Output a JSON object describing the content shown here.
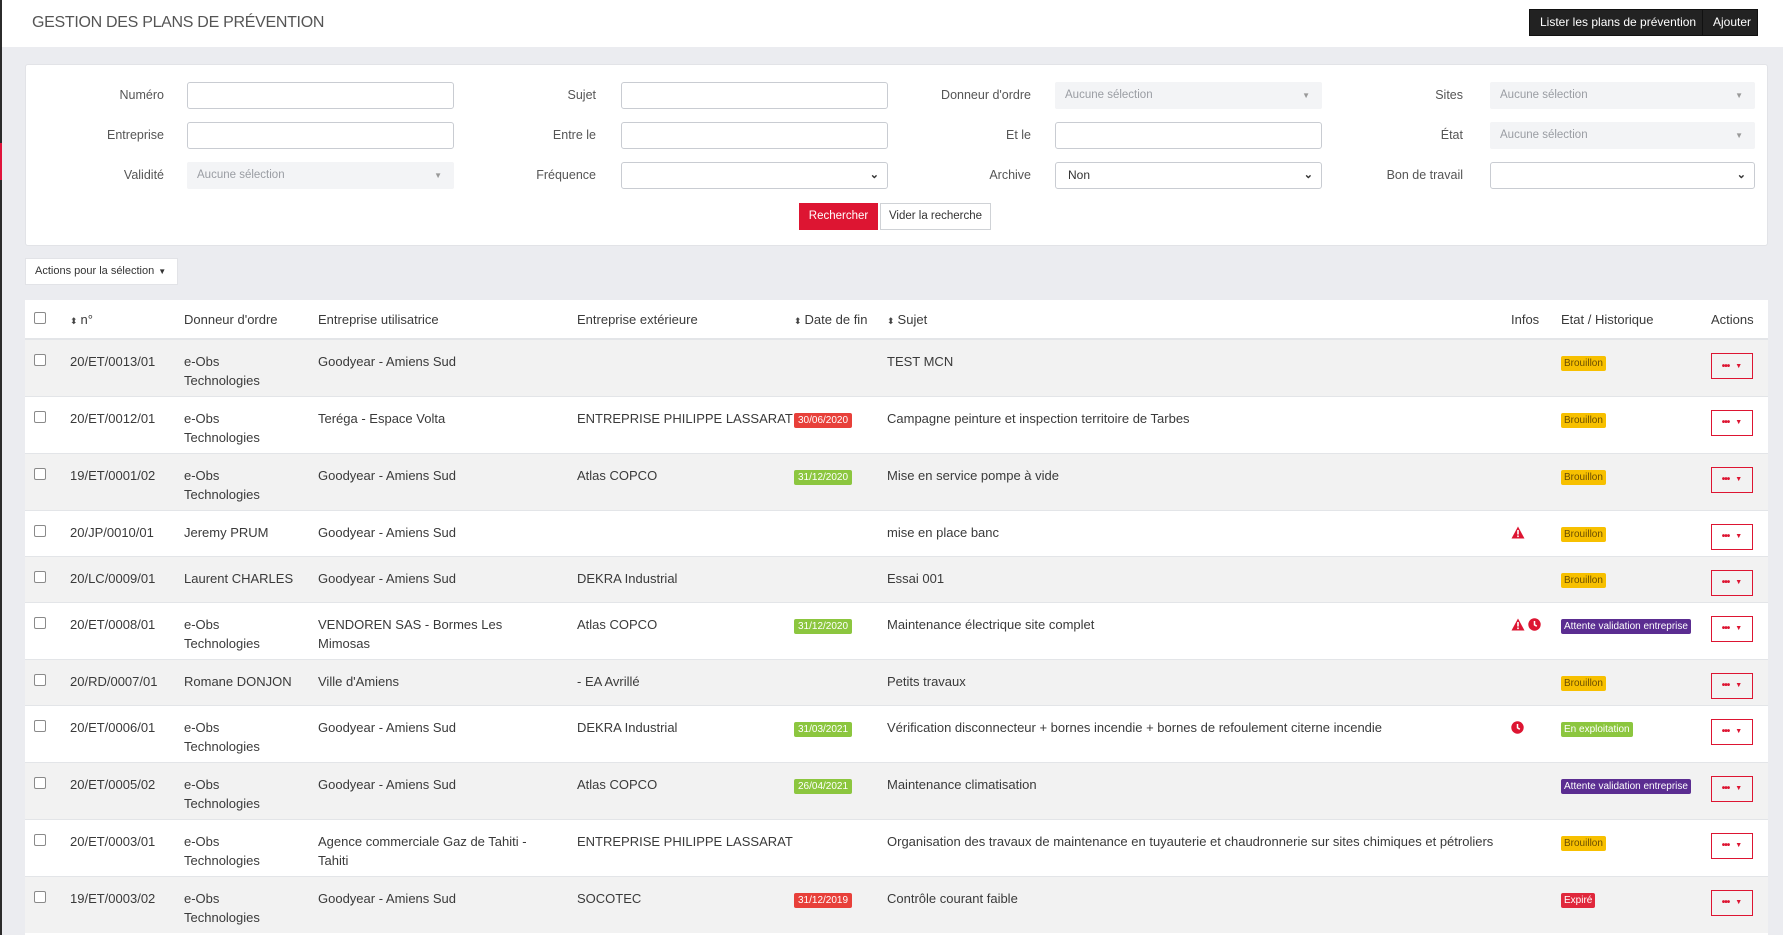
{
  "header": {
    "title": "GESTION DES PLANS DE PRÉVENTION",
    "list_button": "Lister les plans de prévention",
    "add_button": "Ajouter"
  },
  "filters": {
    "numero": {
      "label": "Numéro",
      "value": ""
    },
    "sujet": {
      "label": "Sujet",
      "value": ""
    },
    "donneur": {
      "label": "Donneur d'ordre",
      "value": "Aucune sélection"
    },
    "sites": {
      "label": "Sites",
      "value": "Aucune sélection"
    },
    "entreprise": {
      "label": "Entreprise",
      "value": ""
    },
    "entre_le": {
      "label": "Entre le",
      "value": ""
    },
    "et_le": {
      "label": "Et le",
      "value": ""
    },
    "etat": {
      "label": "État",
      "value": "Aucune sélection"
    },
    "validite": {
      "label": "Validité",
      "value": "Aucune sélection"
    },
    "frequence": {
      "label": "Fréquence",
      "value": ""
    },
    "archive": {
      "label": "Archive",
      "value": "Non"
    },
    "bon_travail": {
      "label": "Bon de travail",
      "value": ""
    },
    "search_button": "Rechercher",
    "clear_button": "Vider la recherche"
  },
  "bulk_actions": "Actions pour la sélection",
  "colors": {
    "accent_red": "#dd1532",
    "brouillon": "#f7c000",
    "attente": "#5b2d91",
    "exploitation": "#8cc63f",
    "expire": "#e0283c",
    "date_green": "#8cc63f",
    "date_red": "#e8403a"
  },
  "table": {
    "headers": {
      "num": "n°",
      "donneur": "Donneur d'ordre",
      "utilisatrice": "Entreprise utilisatrice",
      "exterieure": "Entreprise extérieure",
      "date_fin": "Date de fin",
      "sujet": "Sujet",
      "infos": "Infos",
      "etat": "Etat / Historique",
      "actions": "Actions"
    },
    "rows": [
      {
        "num": "20/ET/0013/01",
        "donneur": "e-Obs Technologies",
        "utilisatrice": "Goodyear - Amiens Sud",
        "exterieure": "",
        "date_fin": "",
        "date_status": "",
        "sujet": "TEST MCN",
        "infos": [],
        "etat": "Brouillon",
        "etat_type": "brouillon"
      },
      {
        "num": "20/ET/0012/01",
        "donneur": "e-Obs Technologies",
        "utilisatrice": "Teréga - Espace Volta",
        "exterieure": "ENTREPRISE PHILIPPE LASSARAT",
        "date_fin": "30/06/2020",
        "date_status": "red",
        "sujet": "Campagne peinture et inspection territoire de Tarbes",
        "infos": [],
        "etat": "Brouillon",
        "etat_type": "brouillon"
      },
      {
        "num": "19/ET/0001/02",
        "donneur": "e-Obs Technologies",
        "utilisatrice": "Goodyear - Amiens Sud",
        "exterieure": "Atlas COPCO",
        "date_fin": "31/12/2020",
        "date_status": "green",
        "sujet": "Mise en service pompe à vide",
        "infos": [],
        "etat": "Brouillon",
        "etat_type": "brouillon"
      },
      {
        "num": "20/JP/0010/01",
        "donneur": "Jeremy PRUM",
        "utilisatrice": "Goodyear - Amiens Sud",
        "exterieure": "",
        "date_fin": "",
        "date_status": "",
        "sujet": "mise en place banc",
        "infos": [
          "warning"
        ],
        "etat": "Brouillon",
        "etat_type": "brouillon"
      },
      {
        "num": "20/LC/0009/01",
        "donneur": "Laurent CHARLES",
        "utilisatrice": "Goodyear - Amiens Sud",
        "exterieure": "DEKRA Industrial",
        "date_fin": "",
        "date_status": "",
        "sujet": "Essai 001",
        "infos": [],
        "etat": "Brouillon",
        "etat_type": "brouillon"
      },
      {
        "num": "20/ET/0008/01",
        "donneur": "e-Obs Technologies",
        "utilisatrice": "VENDOREN SAS - Bormes Les Mimosas",
        "exterieure": "Atlas COPCO",
        "date_fin": "31/12/2020",
        "date_status": "green",
        "sujet": "Maintenance électrique site complet",
        "infos": [
          "warning",
          "clock"
        ],
        "etat": "Attente validation entreprise",
        "etat_type": "attente"
      },
      {
        "num": "20/RD/0007/01",
        "donneur": "Romane DONJON",
        "utilisatrice": "Ville d'Amiens",
        "exterieure": "- EA Avrillé",
        "date_fin": "",
        "date_status": "",
        "sujet": "Petits travaux",
        "infos": [],
        "etat": "Brouillon",
        "etat_type": "brouillon"
      },
      {
        "num": "20/ET/0006/01",
        "donneur": "e-Obs Technologies",
        "utilisatrice": "Goodyear - Amiens Sud",
        "exterieure": "DEKRA Industrial",
        "date_fin": "31/03/2021",
        "date_status": "green",
        "sujet": "Vérification disconnecteur + bornes incendie + bornes de refoulement citerne incendie",
        "infos": [
          "clock"
        ],
        "etat": "En exploitation",
        "etat_type": "exploitation"
      },
      {
        "num": "20/ET/0005/02",
        "donneur": "e-Obs Technologies",
        "utilisatrice": "Goodyear - Amiens Sud",
        "exterieure": "Atlas COPCO",
        "date_fin": "26/04/2021",
        "date_status": "green",
        "sujet": "Maintenance climatisation",
        "infos": [],
        "etat": "Attente validation entreprise",
        "etat_type": "attente"
      },
      {
        "num": "20/ET/0003/01",
        "donneur": "e-Obs Technologies",
        "utilisatrice": "Agence commerciale Gaz de Tahiti - Tahiti",
        "exterieure": "ENTREPRISE PHILIPPE LASSARAT",
        "date_fin": "",
        "date_status": "",
        "sujet": "Organisation des travaux de maintenance en tuyauterie et chaudronnerie sur sites chimiques et pétroliers",
        "infos": [],
        "etat": "Brouillon",
        "etat_type": "brouillon"
      },
      {
        "num": "19/ET/0003/02",
        "donneur": "e-Obs Technologies",
        "utilisatrice": "Goodyear - Amiens Sud",
        "exterieure": "SOCOTEC",
        "date_fin": "31/12/2019",
        "date_status": "red",
        "sujet": "Contrôle courant faible",
        "infos": [],
        "etat": "Expiré",
        "etat_type": "expire"
      }
    ]
  }
}
